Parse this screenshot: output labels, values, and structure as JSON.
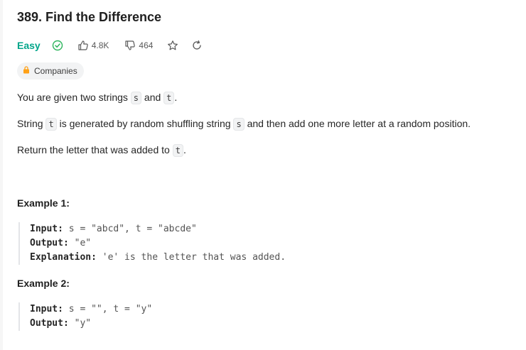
{
  "problem": {
    "title": "389. Find the Difference",
    "difficulty": "Easy",
    "likes": "4.8K",
    "dislikes": "464",
    "companies_label": "Companies"
  },
  "description": {
    "p1": {
      "a": "You are given two strings ",
      "code1": "s",
      "b": " and ",
      "code2": "t",
      "c": "."
    },
    "p2": {
      "a": "String ",
      "code1": "t",
      "b": " is generated by random shuffling string ",
      "code2": "s",
      "c": " and then add one more letter at a random position."
    },
    "p3": {
      "a": "Return the letter that was added to ",
      "code1": "t",
      "c": "."
    }
  },
  "examples": [
    {
      "heading": "Example 1:",
      "input_label": "Input:",
      "input_value": " s = \"abcd\", t = \"abcde\"",
      "output_label": "Output:",
      "output_value": " \"e\"",
      "explanation_label": "Explanation:",
      "explanation_value": " 'e' is the letter that was added."
    },
    {
      "heading": "Example 2:",
      "input_label": "Input:",
      "input_value": " s = \"\", t = \"y\"",
      "output_label": "Output:",
      "output_value": " \"y\""
    }
  ],
  "colors": {
    "easy": "#00a58a",
    "text": "#262626",
    "muted": "#595959",
    "chip_bg": "#f2f3f4",
    "lock": "#ffa116"
  },
  "icons": [
    "check-circle-icon",
    "thumbs-up-icon",
    "thumbs-down-icon",
    "star-icon",
    "refresh-icon",
    "lock-icon"
  ]
}
